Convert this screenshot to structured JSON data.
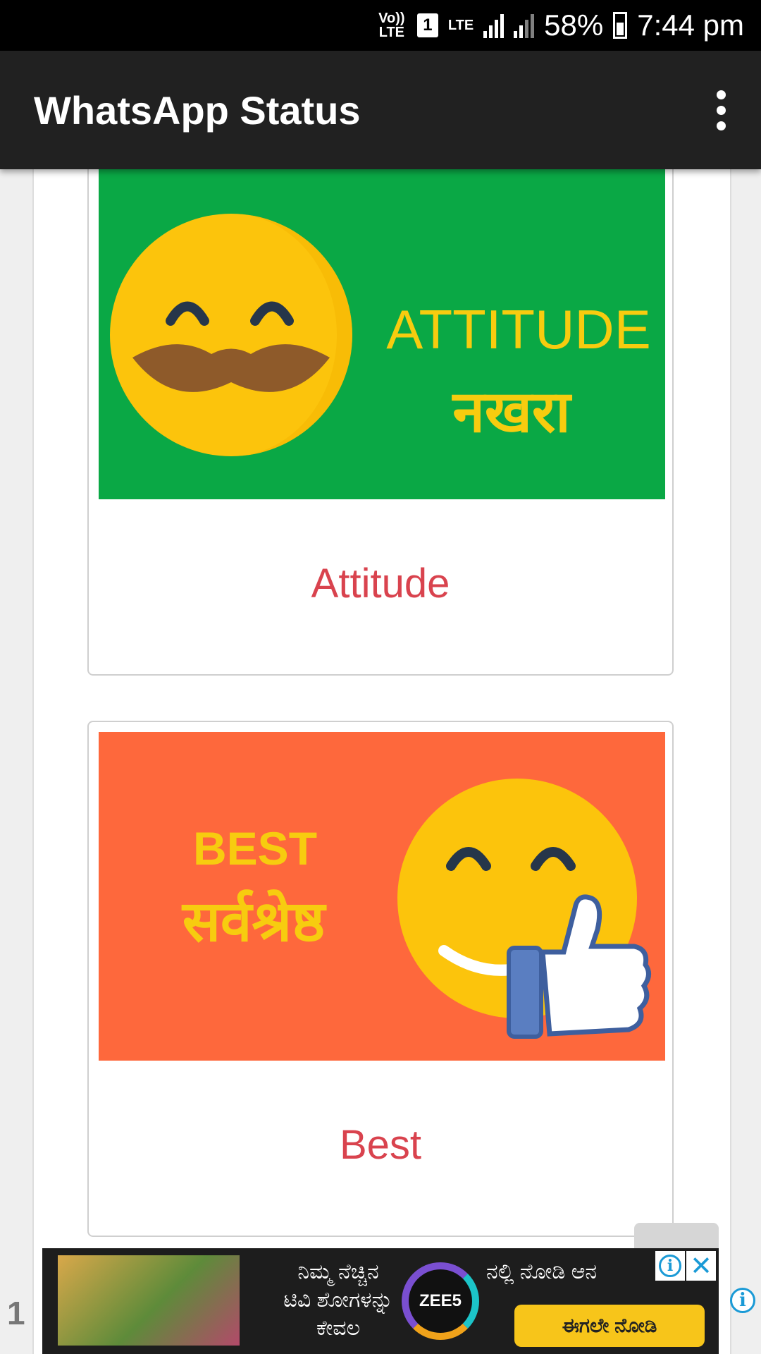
{
  "status_bar": {
    "volte": "Vo)) LTE",
    "sim_slot": "1",
    "network": "LTE",
    "battery": "58%",
    "time": "7:44 pm"
  },
  "app_bar": {
    "title": "WhatsApp Status",
    "menu_icon": "more-vert-icon"
  },
  "cards": [
    {
      "label": "Attitude",
      "image_text_en": "ATTITUDE",
      "image_text_hi": "नखरा",
      "image_bg": "#0aa845"
    },
    {
      "label": "Best",
      "image_text_en": "BEST",
      "image_text_hi": "सर्वश्रेष्ठ",
      "image_bg": "#fe683c"
    }
  ],
  "ad": {
    "side_number": "1",
    "line1": "ನಿಮ್ಮ ನೆಚ್ಚಿನ",
    "line2": "ಟಿವಿ ಶೋಗಳನ್ನು",
    "line3": "ಕೇವಲ",
    "brand": "ZEE5",
    "line4": "ನಲ್ಲಿ ನೋಡಿ ಆನ",
    "cta": "ಈಗಲೇ ನೋಡಿ",
    "close_icon": "close-icon",
    "info_icon": "info-icon"
  },
  "colors": {
    "app_bar": "#212121",
    "label_red": "#d9434e",
    "emoji_yellow": "#fcc40c",
    "text_yellow": "#f7cc0f"
  }
}
